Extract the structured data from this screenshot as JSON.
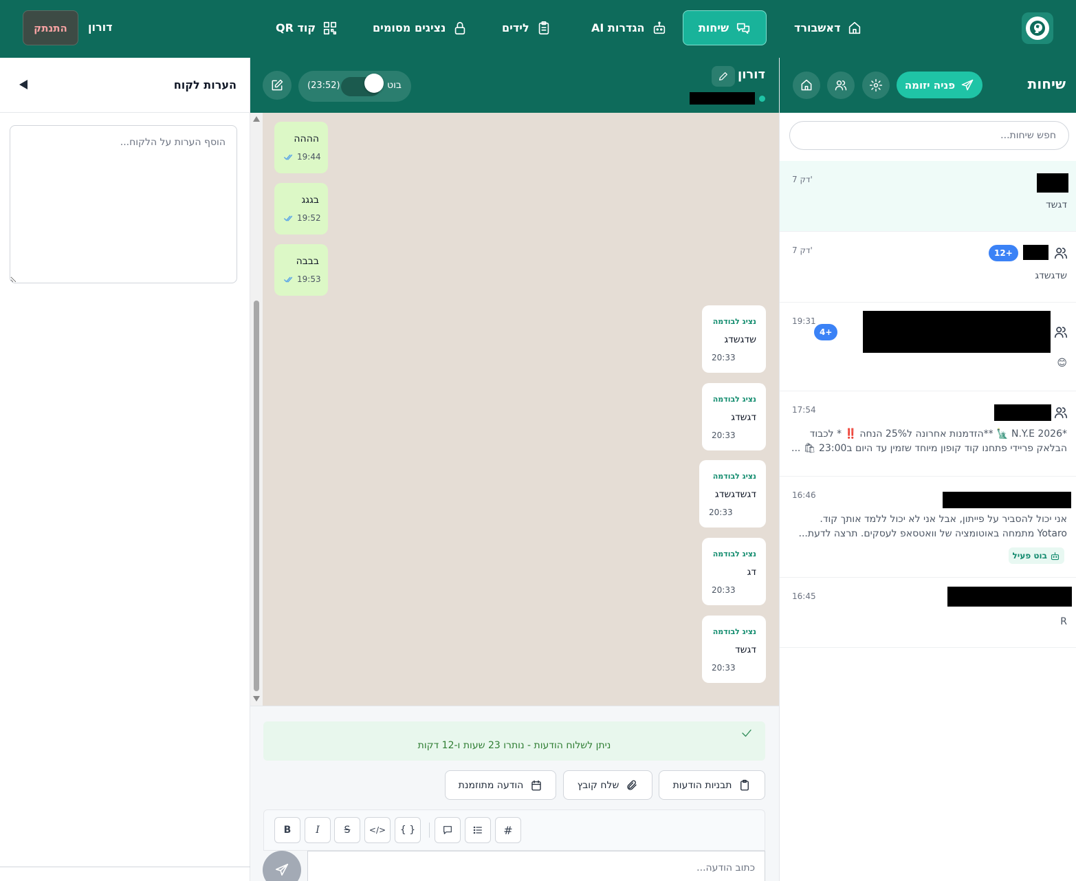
{
  "topnav": {
    "items": [
      {
        "label": "דאשבורד",
        "icon": "home-icon"
      },
      {
        "label": "שיחות",
        "icon": "chat-bubbles-icon",
        "active": true
      },
      {
        "label": "הגדרות AI",
        "icon": "robot-icon"
      },
      {
        "label": "לידים",
        "icon": "clipboard-icon"
      },
      {
        "label": "נציגים מסומים",
        "icon": "lock-icon"
      },
      {
        "label": "קוד QR",
        "icon": "qr-code-icon"
      }
    ],
    "user_name": "דורון",
    "logout_label": "התנתק"
  },
  "sidebar": {
    "title": "שיחות",
    "new_chat_label": "פניה יזומה",
    "search_placeholder": "חפש שיחות...",
    "chats": [
      {
        "time": "7 דק'",
        "preview_lines": [
          "דגשד"
        ],
        "active": true
      },
      {
        "time": "7 דק'",
        "preview_lines": [
          "שדגשדג"
        ],
        "group": true,
        "badge": "12+"
      },
      {
        "time": "19:31",
        "preview_lines": [
          "😊"
        ],
        "group": true,
        "badge": "4+"
      },
      {
        "time": "17:54",
        "preview_lines": [
          "*N.Y.E 2026 🗽 **הזדמנות אחרונה ל25% הנחה ‼️ * לכבוד",
          "הבלאק פריידי פתחנו קוד קופון מיוחד שזמין עד היום ב23:00 🛍 ..."
        ],
        "group": true
      },
      {
        "time": "16:46",
        "preview_lines": [
          "אני יכול להסביר על פייתון, אבל אני לא יכול ללמד אותך קוד.",
          "Yotaro מתמחה באוטומציה של וואטסאפ לעסקים. תרצה לדעת..."
        ],
        "bot_badge": "בוט פעיל"
      },
      {
        "time": "16:45",
        "preview_lines": [
          "R"
        ]
      }
    ]
  },
  "chat": {
    "contact_name": "דורון",
    "bot_label": "בוט",
    "bot_timer": "(23:52)",
    "bot_enabled": true,
    "incoming": [
      {
        "text": "הההה",
        "time": "19:44"
      },
      {
        "text": "בגגג",
        "time": "19:52"
      },
      {
        "text": "בבבה",
        "time": "19:53"
      }
    ],
    "outgoing": [
      {
        "sender": "נציג לבודמה",
        "text": "שדגשדג",
        "time": "20:33"
      },
      {
        "sender": "נציג לבודמה",
        "text": "דגשדג",
        "time": "20:33"
      },
      {
        "sender": "נציג לבודמה",
        "text": "דגשדגשדג",
        "time": "20:33"
      },
      {
        "sender": "נציג לבודמה",
        "text": "דג",
        "time": "20:33"
      },
      {
        "sender": "נציג לבודמה",
        "text": "דגשד",
        "time": "20:33"
      }
    ],
    "info_text": "ניתן לשלוח הודעות - נותרו 23 שעות ו-12 דקות",
    "actions": {
      "templates": "תבניות הודעות",
      "send_file": "שלח קובץ",
      "scheduled": "הודעה מתוזמנת"
    },
    "format": {
      "bold": "B",
      "italic": "I",
      "strike": "S",
      "code": "</>",
      "braces": "{ }",
      "hash": "#"
    },
    "input_placeholder": "כתוב הודעה..."
  },
  "notes": {
    "title": "הערות לקוח",
    "placeholder": "הוסף הערות על הלקוח..."
  }
}
